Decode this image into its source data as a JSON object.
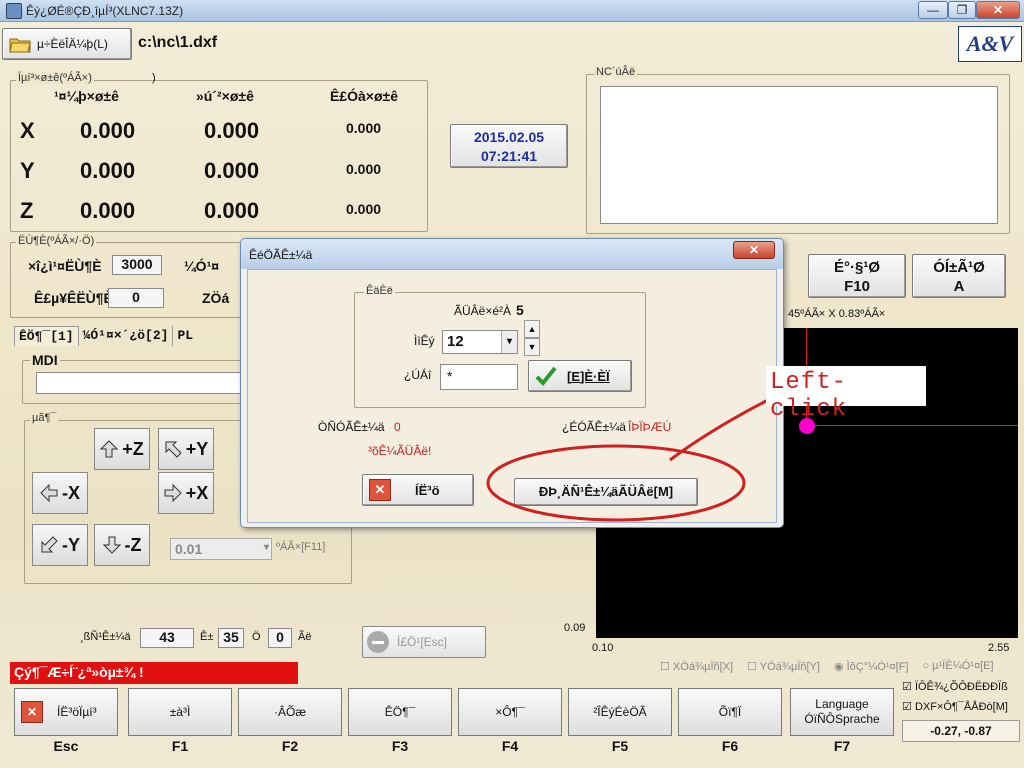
{
  "window": {
    "title": "Êý¿ØÉ®ÇÐ¸îµÍ³(XLNC7.13Z)",
    "min_label": "—",
    "max_label": "❐",
    "close_label": "✕"
  },
  "toolbar": {
    "open_label": "µ÷ÈëÎÄ¼þ(L)",
    "file_path": "c:\\nc\\1.dxf",
    "logo_text": "A&V"
  },
  "coords": {
    "group_label": "Ïµí³×ø±ê(ºÁÃ×)",
    "col1": "¹¤¼þ×ø±ê",
    "col2": "»ú´²×ø±ê",
    "col3": "Ê£Óà×ø±ê",
    "rows": [
      {
        "axis": "X",
        "work": "0.000",
        "machine": "0.000",
        "remain": "0.000"
      },
      {
        "axis": "Y",
        "work": "0.000",
        "machine": "0.000",
        "remain": "0.000"
      },
      {
        "axis": "Z",
        "work": "0.000",
        "machine": "0.000",
        "remain": "0.000"
      }
    ]
  },
  "datetime": {
    "date": "2015.02.05",
    "time": "07:21:41"
  },
  "nc_code": {
    "label": "NC´úÂë"
  },
  "speed": {
    "group_label": "ËÙ¶È(ºÁÃ×/·Ö)",
    "feed_label": "×î¿ì¹¤ËÙ¶È",
    "feed_value": "3000",
    "second_label": "¼Ó¹¤",
    "third_label": "Ê£µ¥ÊËÙ¶È",
    "third_value": "0",
    "fourth_label": "ZÖá"
  },
  "tabs": {
    "tab1": "ÊÖ¶¯[1]",
    "tab2": "¼Ó¹¤×´¿ö[2]",
    "tab3": "PL"
  },
  "mdi": {
    "label": "MDI"
  },
  "jog": {
    "group_label": "µã¶¯",
    "plus_z": "+Z",
    "plus_y": "+Y",
    "minus_x": "-X",
    "plus_x": "+X",
    "minus_y": "-Y",
    "minus_z": "-Z",
    "step_value": "0.01",
    "step_unit": "ºÁÃ×[F11]"
  },
  "right_panel": {
    "f10_label": "É°·§¹Ø",
    "f10_key": "F10",
    "a_label": "ÓÍ±Ã¹Ø",
    "a_key": "A",
    "scale_text": "45ºÁÃ× X 0.83ºÁÃ×"
  },
  "plot": {
    "y_top": "0.09",
    "x_left": "0.10",
    "x_right": "2.55"
  },
  "status": {
    "line_label": "¸ßÑ¹Ê±¼ä",
    "line_value": "43",
    "e_label": "Ê±",
    "e_value": "35",
    "s_label": "Ö",
    "s_value": "0",
    "s_unit": "Ãë",
    "stop_label": "Í£Ö¹[Esc]",
    "alarm": "Çý¶¯Æ÷Í¨¿ª»òµ±¾ !"
  },
  "options": {
    "x_mirror": "XÖá¾µÏñ[X]",
    "y_mirror": "YÖá¾µÏñ[Y]",
    "radio1": "ÌõÇ°¼Ó¹¤[F]",
    "radio2": "µ¹ÏÈ¼Ó¹¤[E]",
    "check1": "ÏÔÊ¾¿ÕÔÐËÐÐÏß",
    "check2": "DXF×Ô¶¯ÅÅÐò[M]",
    "coord_readout": "-0.27,  -0.87"
  },
  "fkeys": [
    {
      "label": "ÍË³öÏµí³",
      "key": "Esc"
    },
    {
      "label": "±à³Ì",
      "key": "F1"
    },
    {
      "label": "·ÂÕæ",
      "key": "F2"
    },
    {
      "label": "ÊÖ¶¯",
      "key": "F3"
    },
    {
      "label": "×Ô¶¯",
      "key": "F4"
    },
    {
      "label": "²ÎÊýÉèÖÃ",
      "key": "F5"
    },
    {
      "label": "Õï¶Ï",
      "key": "F6"
    },
    {
      "label": "Language\nÓïÑÔSprache",
      "key": "F7"
    }
  ],
  "dialog": {
    "title": "ÊéÖÃÊ±¼ä",
    "close_label": "✕",
    "group_label": "ÊäÈë",
    "count_label": "ÃÜÂë×é²À",
    "count_value": "5",
    "days_label": "ÌìÊý",
    "days_value": "12",
    "pwd_label": "¿ÚÁî",
    "pwd_value": "*",
    "confirm_label": "[E]È·ÈÏ",
    "used_label": "ÒÑÓÃÊ±¼ä",
    "used_value": "0",
    "remain_label": "¿ÉÓÃÊ±¼ä",
    "remain_value": "ÎÞÏÞÆÚ",
    "expired_label": "³õÊ¼ÃÜÂë!",
    "cancel_label": "ÍË³ö",
    "modify_label": "ÐÞ¸ÄÑ¹Ê±¼äÃÜÂë[M]"
  },
  "annotation": {
    "text": "Left-click"
  },
  "colors": {
    "accent_blue": "#1a2fa0",
    "alarm_red": "#e01010",
    "highlight_magenta": "#ff00cc",
    "annotation_red": "#d02020"
  }
}
